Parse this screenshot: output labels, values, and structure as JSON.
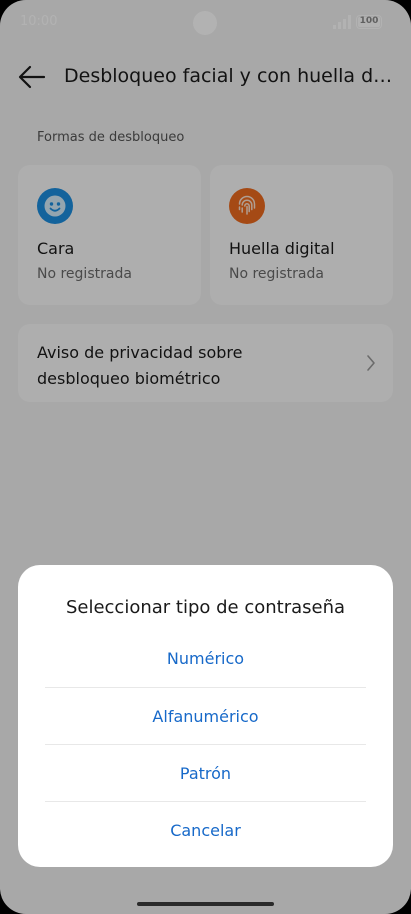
{
  "status_bar": {
    "time": "10:00",
    "battery": "100"
  },
  "header": {
    "title": "Desbloqueo facial y con huella digital"
  },
  "section": {
    "label": "Formas de desbloqueo"
  },
  "cards": [
    {
      "title": "Cara",
      "status": "No registrada",
      "icon": "face-icon",
      "color": "#1c8ee0"
    },
    {
      "title": "Huella digital",
      "status": "No registrada",
      "icon": "fingerprint-icon",
      "color": "#ec6a1f"
    }
  ],
  "privacy": {
    "label": "Aviso de privacidad sobre desbloqueo biométrico"
  },
  "dialog": {
    "title": "Seleccionar tipo de contraseña",
    "options": [
      "Numérico",
      "Alfanumérico",
      "Patrón"
    ],
    "cancel": "Cancelar",
    "accent": "#1769c9"
  }
}
